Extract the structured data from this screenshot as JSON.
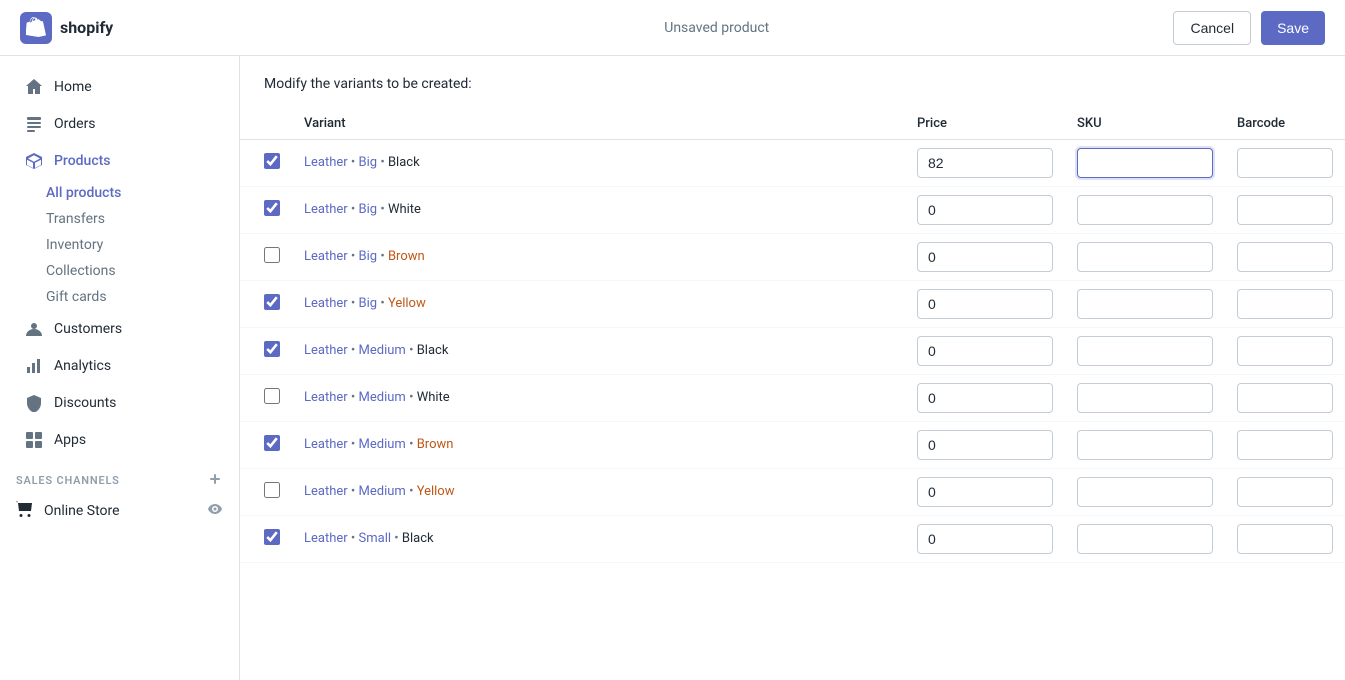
{
  "topbar": {
    "logo_text": "shopify",
    "page_title": "Unsaved product",
    "cancel_label": "Cancel",
    "save_label": "Save"
  },
  "sidebar": {
    "items": [
      {
        "id": "home",
        "label": "Home",
        "icon": "home"
      },
      {
        "id": "orders",
        "label": "Orders",
        "icon": "orders"
      },
      {
        "id": "products",
        "label": "Products",
        "icon": "products",
        "active": true,
        "sub_items": [
          {
            "id": "all-products",
            "label": "All products",
            "active": true
          },
          {
            "id": "transfers",
            "label": "Transfers"
          },
          {
            "id": "inventory",
            "label": "Inventory"
          },
          {
            "id": "collections",
            "label": "Collections"
          },
          {
            "id": "gift-cards",
            "label": "Gift cards"
          }
        ]
      },
      {
        "id": "customers",
        "label": "Customers",
        "icon": "customers"
      },
      {
        "id": "analytics",
        "label": "Analytics",
        "icon": "analytics"
      },
      {
        "id": "discounts",
        "label": "Discounts",
        "icon": "discounts"
      },
      {
        "id": "apps",
        "label": "Apps",
        "icon": "apps"
      }
    ],
    "sales_channels_label": "SALES CHANNELS",
    "online_store_label": "Online Store"
  },
  "main": {
    "modify_label": "Modify the variants to be created:",
    "table": {
      "headers": [
        "",
        "Variant",
        "Price",
        "SKU",
        "Barcode"
      ],
      "rows": [
        {
          "id": 1,
          "checked": true,
          "parts": [
            "Leather",
            "Big",
            "Black"
          ],
          "colors": [
            "purple",
            "purple",
            "black"
          ],
          "price": "82",
          "sku": "",
          "barcode": "",
          "sku_focused": true
        },
        {
          "id": 2,
          "checked": true,
          "parts": [
            "Leather",
            "Big",
            "White"
          ],
          "colors": [
            "purple",
            "purple",
            "black"
          ],
          "price": "0",
          "sku": "",
          "barcode": ""
        },
        {
          "id": 3,
          "checked": false,
          "parts": [
            "Leather",
            "Big",
            "Brown"
          ],
          "colors": [
            "purple",
            "purple",
            "brown"
          ],
          "price": "0",
          "sku": "",
          "barcode": ""
        },
        {
          "id": 4,
          "checked": true,
          "parts": [
            "Leather",
            "Big",
            "Yellow"
          ],
          "colors": [
            "purple",
            "purple",
            "orange"
          ],
          "price": "0",
          "sku": "",
          "barcode": ""
        },
        {
          "id": 5,
          "checked": true,
          "parts": [
            "Leather",
            "Medium",
            "Black"
          ],
          "colors": [
            "purple",
            "purple",
            "black"
          ],
          "price": "0",
          "sku": "",
          "barcode": ""
        },
        {
          "id": 6,
          "checked": false,
          "parts": [
            "Leather",
            "Medium",
            "White"
          ],
          "colors": [
            "purple",
            "purple",
            "black"
          ],
          "price": "0",
          "sku": "",
          "barcode": ""
        },
        {
          "id": 7,
          "checked": true,
          "parts": [
            "Leather",
            "Medium",
            "Brown"
          ],
          "colors": [
            "purple",
            "purple",
            "brown"
          ],
          "price": "0",
          "sku": "",
          "barcode": ""
        },
        {
          "id": 8,
          "checked": false,
          "parts": [
            "Leather",
            "Medium",
            "Yellow"
          ],
          "colors": [
            "purple",
            "purple",
            "orange"
          ],
          "price": "0",
          "sku": "",
          "barcode": ""
        },
        {
          "id": 9,
          "checked": true,
          "parts": [
            "Leather",
            "Small",
            "Black"
          ],
          "colors": [
            "purple",
            "purple",
            "black"
          ],
          "price": "0",
          "sku": "",
          "barcode": ""
        }
      ]
    }
  }
}
